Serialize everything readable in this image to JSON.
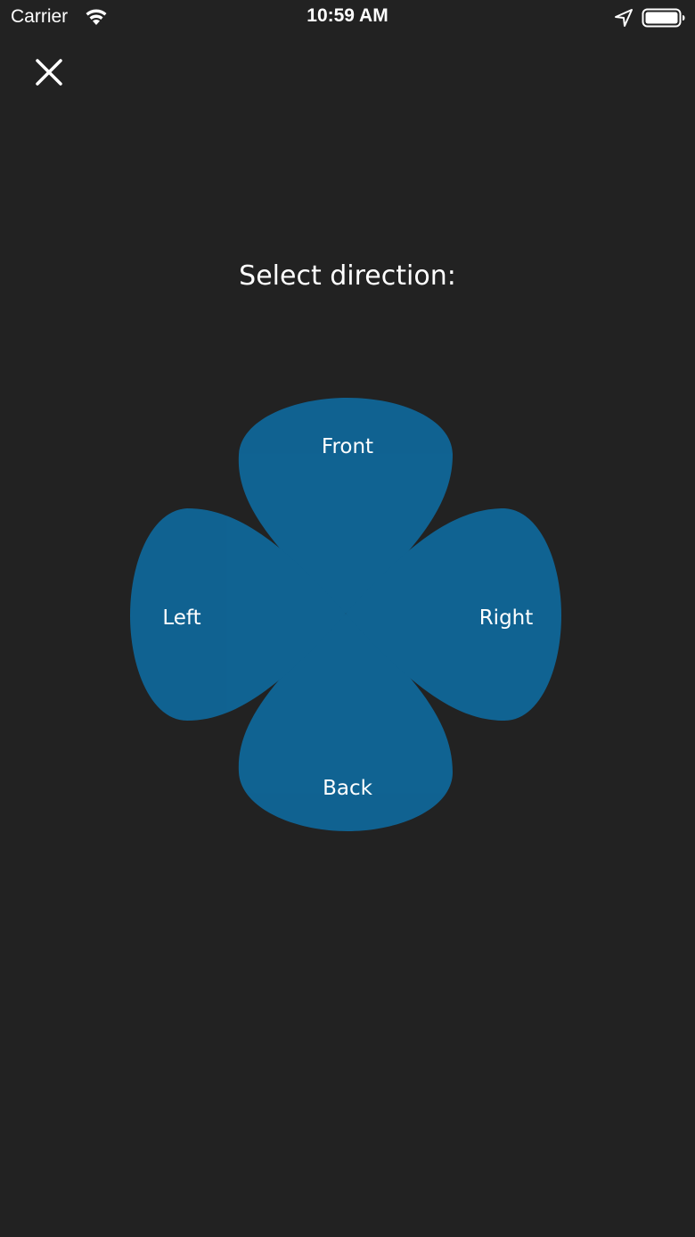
{
  "status_bar": {
    "carrier": "Carrier",
    "time": "10:59 AM",
    "icons": [
      "wifi-icon",
      "location-arrow-icon",
      "battery-icon"
    ]
  },
  "header": {
    "close_icon": "close-icon"
  },
  "main": {
    "title": "Select direction:",
    "directions": {
      "front": "Front",
      "left": "Left",
      "right": "Right",
      "back": "Back"
    }
  },
  "colors": {
    "background": "#222222",
    "petal": "#0a6fa8",
    "overlap": "#0a96d6",
    "text": "#ffffff"
  }
}
